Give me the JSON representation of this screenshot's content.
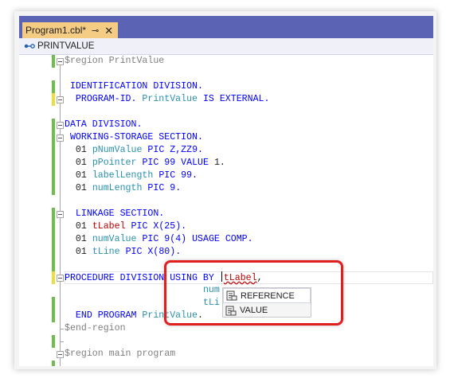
{
  "tab": {
    "title": "Program1.cbl*",
    "pin_glyph": "⊸",
    "close_glyph": "✕"
  },
  "navbar": {
    "label": "PRINTVALUE",
    "icon": "member-icon"
  },
  "code": {
    "l1_region": "$region PrintValue",
    "l3_a": "IDENTIFICATION DIVISION.",
    "l4_a": "PROGRAM-ID.",
    "l4_b": "PrintValue",
    "l4_c": "IS EXTERNAL.",
    "l6_a": "DATA DIVISION.",
    "l7_a": "WORKING-STORAGE SECTION.",
    "l8_a": "01",
    "l8_b": "pNumValue",
    "l8_c": "PIC Z,ZZ9.",
    "l9_a": "01",
    "l9_b": "pPointer",
    "l9_c": "PIC 99",
    "l9_d": "VALUE",
    "l9_e": "1.",
    "l10_a": "01",
    "l10_b": "labelLength",
    "l10_c": "PIC 99.",
    "l11_a": "01",
    "l11_b": "numLength",
    "l11_c": "PIC 9.",
    "l13_a": "LINKAGE SECTION.",
    "l14_a": "01",
    "l14_b": "tLabel",
    "l14_c": "PIC X(25).",
    "l15_a": "01",
    "l15_b": "numValue",
    "l15_c": "PIC 9(4) USAGE COMP.",
    "l16_a": "01",
    "l16_b": "tLine",
    "l16_c": "PIC X(80).",
    "l18_a": "PROCEDURE DIVISION USING BY",
    "l18_b": "tLabel",
    "l18_c": ",",
    "l19_a": "num",
    "l20_a": "tLi",
    "l21_a": "END PROGRAM",
    "l21_b": "PrintValue",
    "l21_c": ".",
    "l22_a": "$end-region",
    "l24_a": "$region main program"
  },
  "completion": {
    "items": [
      {
        "label": "REFERENCE",
        "icon": "keyword-icon"
      },
      {
        "label": "VALUE",
        "icon": "keyword-icon"
      }
    ]
  },
  "colors": {
    "tabbar": "#5b64b4",
    "active_tab": "#f5cc84",
    "keyword": "#0000ff",
    "identifier": "#2b91af",
    "highlight_box": "#e01f1f"
  }
}
